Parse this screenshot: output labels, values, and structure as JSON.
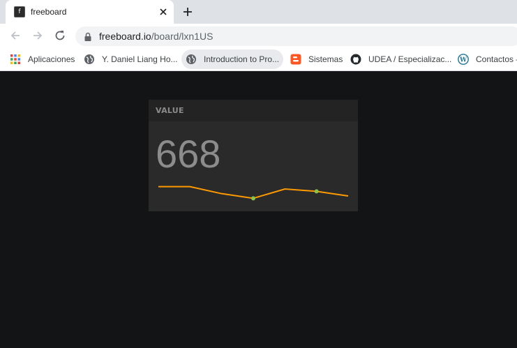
{
  "browser": {
    "tab": {
      "title": "freeboard",
      "favicon": "f"
    },
    "url": {
      "host": "freeboard.io",
      "path": "/board/lxn1US"
    },
    "bookmarks": [
      {
        "label": "Aplicaciones",
        "icon": "apps-grid-icon"
      },
      {
        "label": "Y. Daniel Liang Ho...",
        "icon": "globe-icon"
      },
      {
        "label": "Introduction to Pro...",
        "icon": "globe-icon"
      },
      {
        "label": "Sistemas",
        "icon": "blogger-icon"
      },
      {
        "label": "UDEA / Especializac...",
        "icon": "github-icon"
      },
      {
        "label": "Contactos – ",
        "icon": "wordpress-icon"
      }
    ]
  },
  "widget": {
    "title": "VALUE",
    "value": "668",
    "sparkline": {
      "values": [
        672,
        672,
        669,
        667,
        671,
        670,
        668
      ],
      "ylim": [
        665,
        674
      ],
      "markers": [
        3,
        5
      ],
      "line_color": "#ff9900",
      "marker_color": "#8bc34a"
    }
  },
  "colors": {
    "page_background": "#131416",
    "widget_background": "#2a2a2a",
    "value_text": "#8c8c8c"
  }
}
